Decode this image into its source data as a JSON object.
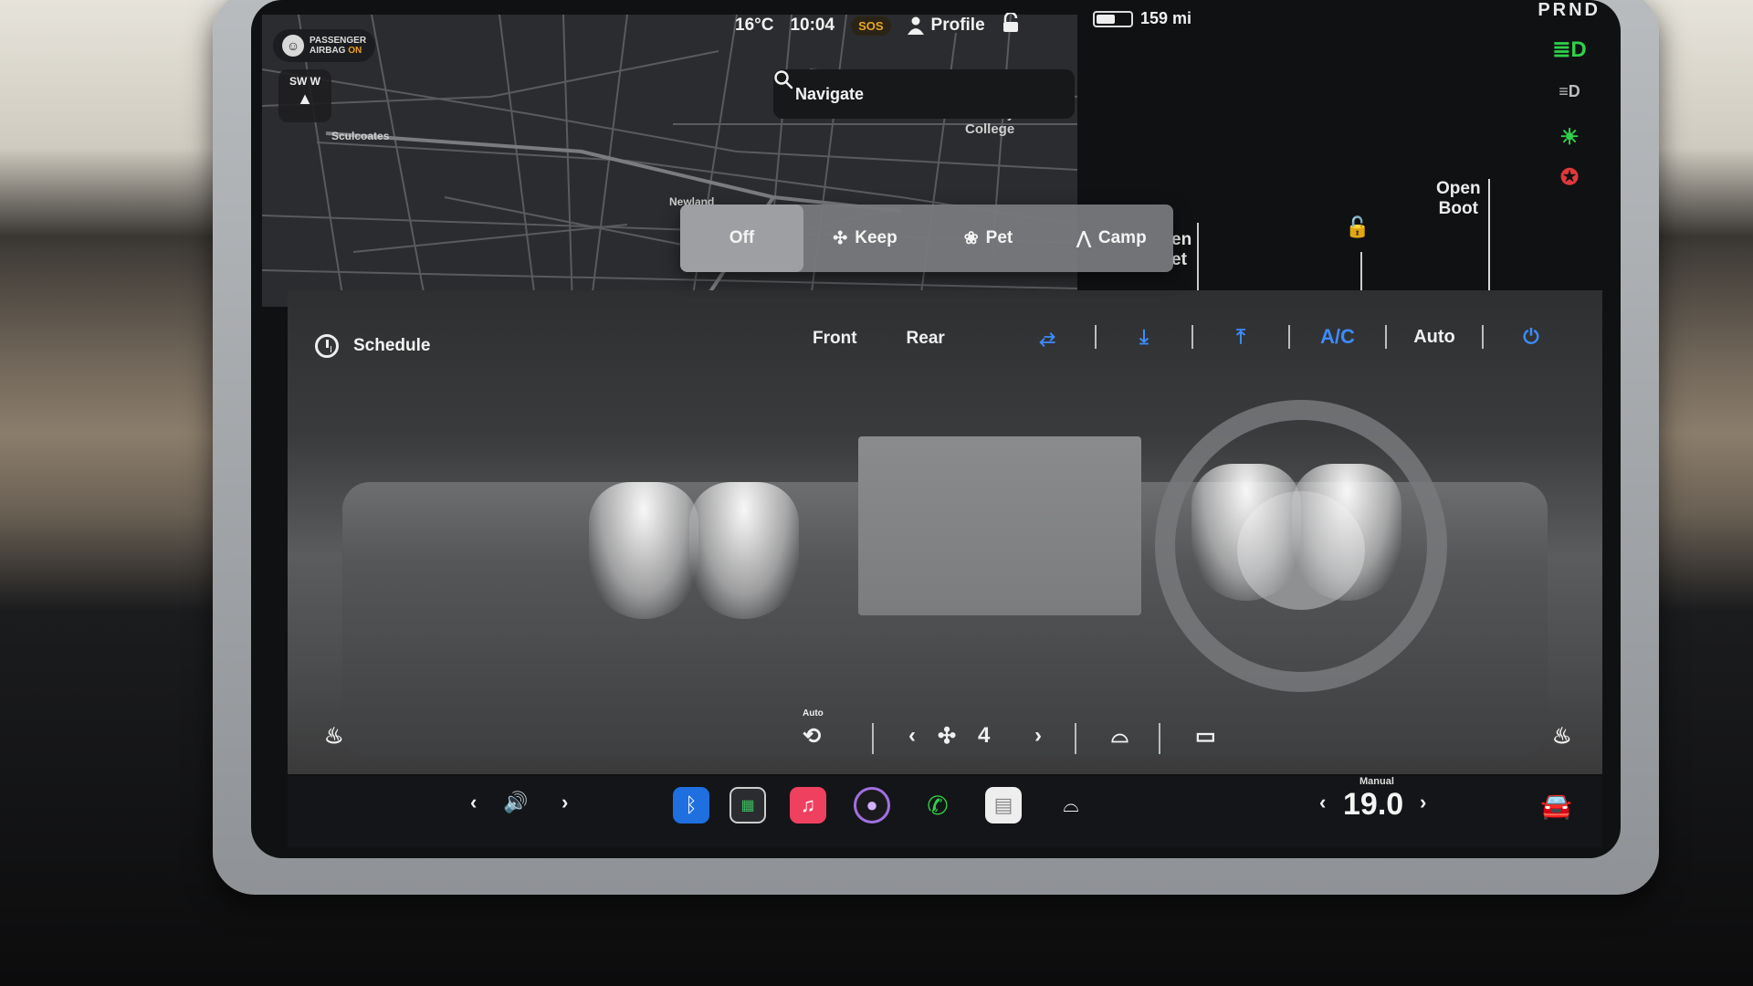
{
  "status": {
    "airbag": {
      "line1": "PASSENGER",
      "line2": "AIRBAG",
      "state": "ON"
    },
    "compass": {
      "heading": "SW W",
      "arrow": "▲"
    },
    "temperature": "16°C",
    "time": "10:04",
    "sos": "SOS",
    "profile": "Profile",
    "range": "159 mi",
    "gear": "PRND",
    "battery_level": 0.55
  },
  "map": {
    "navigate": "Navigate",
    "labels": [
      "Sculcoates",
      "Newland"
    ],
    "poi": "St Mary's College"
  },
  "car_controls": {
    "frunk_partial": "en\net",
    "open_boot": "Open\nBoot"
  },
  "modes": [
    {
      "label": "Off",
      "icon": "",
      "active": true
    },
    {
      "label": "Keep",
      "icon": "fan-icon",
      "active": false
    },
    {
      "label": "Pet",
      "icon": "paw-icon",
      "active": false
    },
    {
      "label": "Camp",
      "icon": "tent-icon",
      "active": false
    }
  ],
  "climate": {
    "schedule": "Schedule",
    "tabs": [
      "Front",
      "Rear"
    ],
    "controls": [
      "A/C",
      "Auto"
    ],
    "recirc_label": "Auto",
    "fan_speed": "4"
  },
  "dock": {
    "temp_mode": "Manual",
    "temperature": "19.0"
  },
  "indicator_colors": {
    "green": "#2fd14a",
    "red": "#e0383b",
    "blue": "#3d8bfd"
  }
}
